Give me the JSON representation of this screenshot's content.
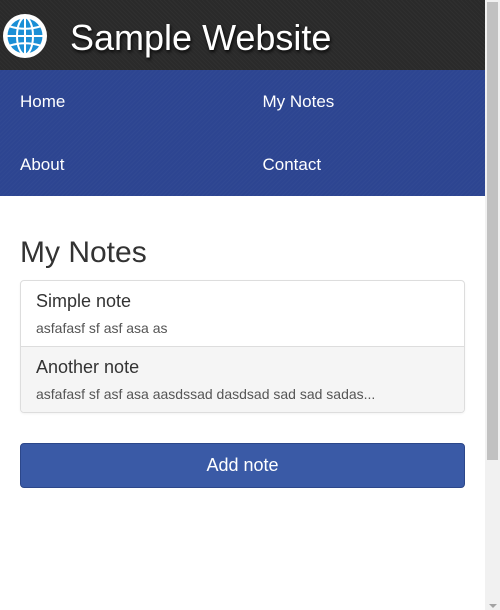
{
  "header": {
    "title": "Sample Website",
    "logo_icon": "globe-icon"
  },
  "nav": {
    "items": [
      {
        "label": "Home"
      },
      {
        "label": "My Notes"
      },
      {
        "label": "About"
      },
      {
        "label": "Contact"
      }
    ]
  },
  "main": {
    "heading": "My Notes",
    "notes": [
      {
        "title": "Simple note",
        "text": "asfafasf sf asf asa as"
      },
      {
        "title": "Another note",
        "text": "asfafasf sf asf asa aasdssad dasdsad sad sad sadas..."
      }
    ],
    "add_button_label": "Add note"
  },
  "colors": {
    "header_bg": "#2a2a2a",
    "nav_bg": "#2d4591",
    "button_bg": "#3a5aa6",
    "globe_blue": "#1a8fd6"
  }
}
